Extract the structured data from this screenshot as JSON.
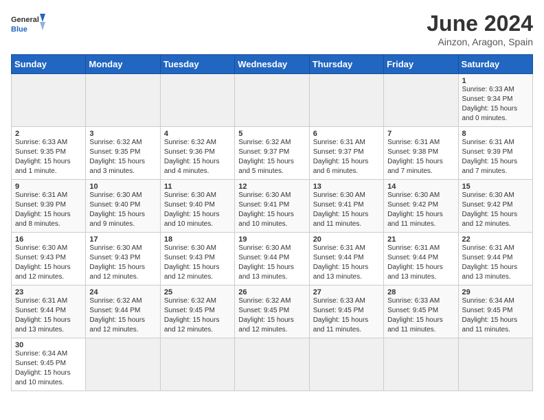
{
  "header": {
    "logo_general": "General",
    "logo_blue": "Blue",
    "title": "June 2024",
    "subtitle": "Ainzon, Aragon, Spain"
  },
  "weekdays": [
    "Sunday",
    "Monday",
    "Tuesday",
    "Wednesday",
    "Thursday",
    "Friday",
    "Saturday"
  ],
  "weeks": [
    [
      {
        "day": "",
        "info": ""
      },
      {
        "day": "",
        "info": ""
      },
      {
        "day": "",
        "info": ""
      },
      {
        "day": "",
        "info": ""
      },
      {
        "day": "",
        "info": ""
      },
      {
        "day": "",
        "info": ""
      },
      {
        "day": "1",
        "info": "Sunrise: 6:33 AM\nSunset: 9:34 PM\nDaylight: 15 hours and 0 minutes."
      }
    ],
    [
      {
        "day": "2",
        "info": "Sunrise: 6:33 AM\nSunset: 9:35 PM\nDaylight: 15 hours and 1 minute."
      },
      {
        "day": "3",
        "info": "Sunrise: 6:32 AM\nSunset: 9:35 PM\nDaylight: 15 hours and 3 minutes."
      },
      {
        "day": "4",
        "info": "Sunrise: 6:32 AM\nSunset: 9:36 PM\nDaylight: 15 hours and 4 minutes."
      },
      {
        "day": "5",
        "info": "Sunrise: 6:32 AM\nSunset: 9:37 PM\nDaylight: 15 hours and 5 minutes."
      },
      {
        "day": "6",
        "info": "Sunrise: 6:31 AM\nSunset: 9:37 PM\nDaylight: 15 hours and 6 minutes."
      },
      {
        "day": "7",
        "info": "Sunrise: 6:31 AM\nSunset: 9:38 PM\nDaylight: 15 hours and 7 minutes."
      },
      {
        "day": "8",
        "info": "Sunrise: 6:31 AM\nSunset: 9:39 PM\nDaylight: 15 hours and 7 minutes."
      }
    ],
    [
      {
        "day": "9",
        "info": "Sunrise: 6:31 AM\nSunset: 9:39 PM\nDaylight: 15 hours and 8 minutes."
      },
      {
        "day": "10",
        "info": "Sunrise: 6:30 AM\nSunset: 9:40 PM\nDaylight: 15 hours and 9 minutes."
      },
      {
        "day": "11",
        "info": "Sunrise: 6:30 AM\nSunset: 9:40 PM\nDaylight: 15 hours and 10 minutes."
      },
      {
        "day": "12",
        "info": "Sunrise: 6:30 AM\nSunset: 9:41 PM\nDaylight: 15 hours and 10 minutes."
      },
      {
        "day": "13",
        "info": "Sunrise: 6:30 AM\nSunset: 9:41 PM\nDaylight: 15 hours and 11 minutes."
      },
      {
        "day": "14",
        "info": "Sunrise: 6:30 AM\nSunset: 9:42 PM\nDaylight: 15 hours and 11 minutes."
      },
      {
        "day": "15",
        "info": "Sunrise: 6:30 AM\nSunset: 9:42 PM\nDaylight: 15 hours and 12 minutes."
      }
    ],
    [
      {
        "day": "16",
        "info": "Sunrise: 6:30 AM\nSunset: 9:43 PM\nDaylight: 15 hours and 12 minutes."
      },
      {
        "day": "17",
        "info": "Sunrise: 6:30 AM\nSunset: 9:43 PM\nDaylight: 15 hours and 12 minutes."
      },
      {
        "day": "18",
        "info": "Sunrise: 6:30 AM\nSunset: 9:43 PM\nDaylight: 15 hours and 12 minutes."
      },
      {
        "day": "19",
        "info": "Sunrise: 6:30 AM\nSunset: 9:44 PM\nDaylight: 15 hours and 13 minutes."
      },
      {
        "day": "20",
        "info": "Sunrise: 6:31 AM\nSunset: 9:44 PM\nDaylight: 15 hours and 13 minutes."
      },
      {
        "day": "21",
        "info": "Sunrise: 6:31 AM\nSunset: 9:44 PM\nDaylight: 15 hours and 13 minutes."
      },
      {
        "day": "22",
        "info": "Sunrise: 6:31 AM\nSunset: 9:44 PM\nDaylight: 15 hours and 13 minutes."
      }
    ],
    [
      {
        "day": "23",
        "info": "Sunrise: 6:31 AM\nSunset: 9:44 PM\nDaylight: 15 hours and 13 minutes."
      },
      {
        "day": "24",
        "info": "Sunrise: 6:32 AM\nSunset: 9:44 PM\nDaylight: 15 hours and 12 minutes."
      },
      {
        "day": "25",
        "info": "Sunrise: 6:32 AM\nSunset: 9:45 PM\nDaylight: 15 hours and 12 minutes."
      },
      {
        "day": "26",
        "info": "Sunrise: 6:32 AM\nSunset: 9:45 PM\nDaylight: 15 hours and 12 minutes."
      },
      {
        "day": "27",
        "info": "Sunrise: 6:33 AM\nSunset: 9:45 PM\nDaylight: 15 hours and 11 minutes."
      },
      {
        "day": "28",
        "info": "Sunrise: 6:33 AM\nSunset: 9:45 PM\nDaylight: 15 hours and 11 minutes."
      },
      {
        "day": "29",
        "info": "Sunrise: 6:34 AM\nSunset: 9:45 PM\nDaylight: 15 hours and 11 minutes."
      }
    ],
    [
      {
        "day": "30",
        "info": "Sunrise: 6:34 AM\nSunset: 9:45 PM\nDaylight: 15 hours and 10 minutes."
      },
      {
        "day": "",
        "info": ""
      },
      {
        "day": "",
        "info": ""
      },
      {
        "day": "",
        "info": ""
      },
      {
        "day": "",
        "info": ""
      },
      {
        "day": "",
        "info": ""
      },
      {
        "day": "",
        "info": ""
      }
    ]
  ]
}
